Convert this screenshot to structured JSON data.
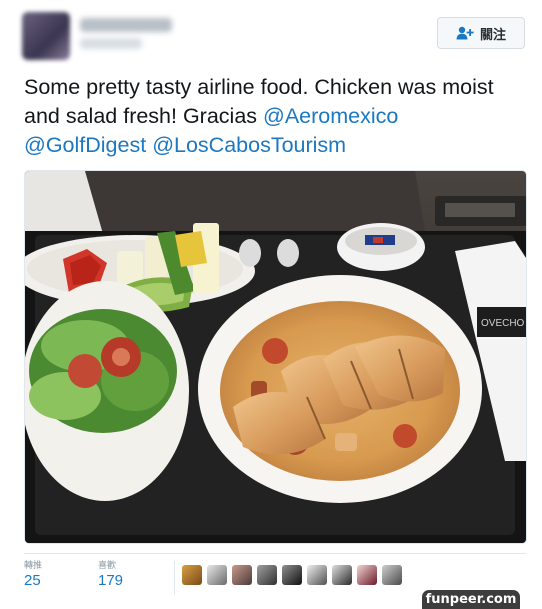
{
  "header": {
    "follow_label": "關注"
  },
  "tweet": {
    "text_plain": "Some pretty tasty airline food. Chicken was moist and salad fresh!  Gracias ",
    "mention_1": "@Aeromexico",
    "mention_2": "@GolfDigest",
    "mention_3": "@LosCabosTourism"
  },
  "stats": {
    "retweets_label": "轉推",
    "retweets_value": "25",
    "likes_label": "喜歡",
    "likes_value": "179"
  },
  "likers_count": 10,
  "watermark": "funpeer.com",
  "colors": {
    "link": "#1b78c2",
    "text": "#14171a",
    "border": "#e1e8ed",
    "muted": "#8899a6"
  },
  "icons": {
    "follow": "add-user-icon"
  }
}
